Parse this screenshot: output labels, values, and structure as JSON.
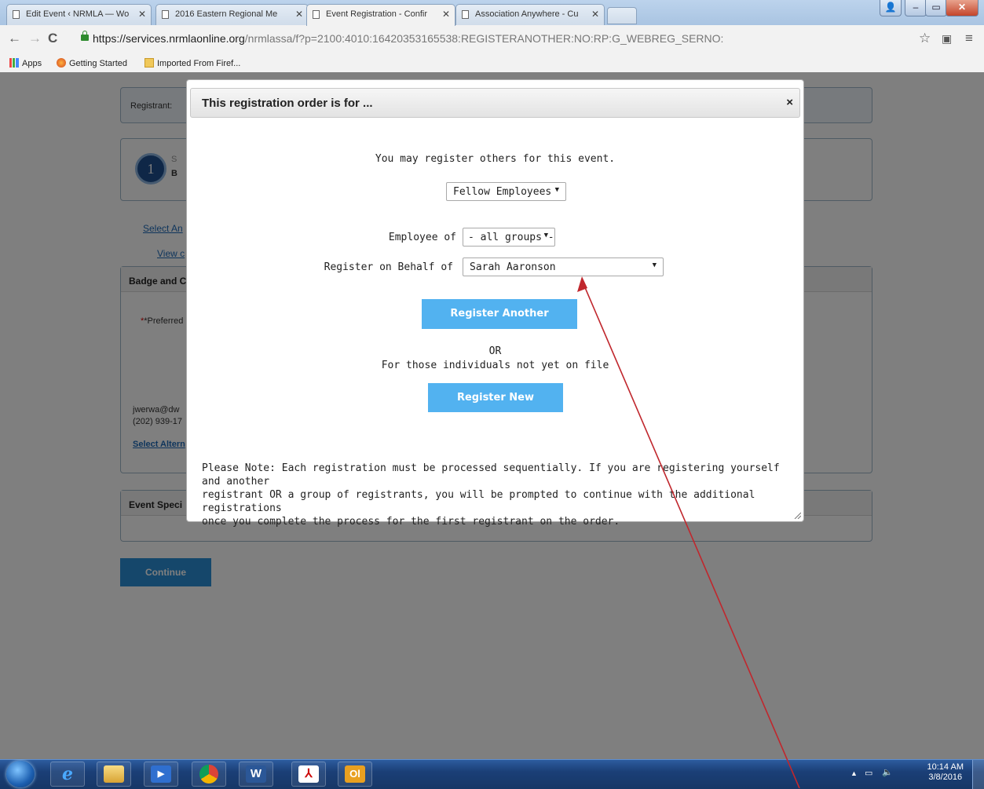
{
  "browser": {
    "tabs": [
      {
        "label": "Edit Event ‹ NRMLA — Wo",
        "active": false
      },
      {
        "label": "2016 Eastern Regional Me",
        "active": false
      },
      {
        "label": "Event Registration - Confir",
        "active": true
      },
      {
        "label": "Association Anywhere - Cu",
        "active": false
      }
    ],
    "url_host": "https://services.nrmlaonline.org",
    "url_path": "/nrmlassa/f?p=2100:4010:16420353165538:REGISTERANOTHER:NO:RP:G_WEBREG_SERNO:",
    "bookmarks": [
      "Apps",
      "Getting Started",
      "Imported From Firef..."
    ]
  },
  "page": {
    "registrant_label": "Registrant:",
    "step_number": "1",
    "step_letter_a": "S",
    "step_letter_b": "B",
    "select_link": "Select An",
    "view_link": "View c",
    "badge_head": "Badge and C",
    "preferred_label": "*Preferred",
    "email": "jwerwa@dw",
    "phone": "(202) 939-17",
    "select_alt_link": "Select Altern",
    "event_spec_head": "Event Speci",
    "continue_label": "Continue"
  },
  "modal": {
    "title": "This registration order is for ...",
    "close_glyph": "×",
    "intro": "You may register others for this event.",
    "group_select": "Fellow Employees",
    "employee_of_label": "Employee of",
    "employee_of_value": "- all groups -",
    "behalf_label": "Register on Behalf of",
    "behalf_value": "Sarah Aaronson",
    "register_another": "Register Another",
    "or_text": "OR",
    "not_on_file": "For those individuals not yet on file",
    "register_new": "Register New",
    "note_line1": "Please Note: Each registration must be processed sequentially. If you are registering yourself and another",
    "note_line2": "registrant OR a group of registrants, you will be prompted to continue with the additional registrations",
    "note_line3": "once you complete the process for the first registrant on the order."
  },
  "taskbar": {
    "apps": [
      "internet-explorer-icon",
      "file-explorer-icon",
      "media-player-icon",
      "chrome-icon",
      "word-icon",
      "acrobat-icon",
      "outlook-icon"
    ],
    "time": "10:14 AM",
    "date": "3/8/2016"
  },
  "colors": {
    "accent_button": "#52b2f0",
    "continue_button": "#2a8fd6",
    "annotation_arrow": "#c0272d"
  }
}
